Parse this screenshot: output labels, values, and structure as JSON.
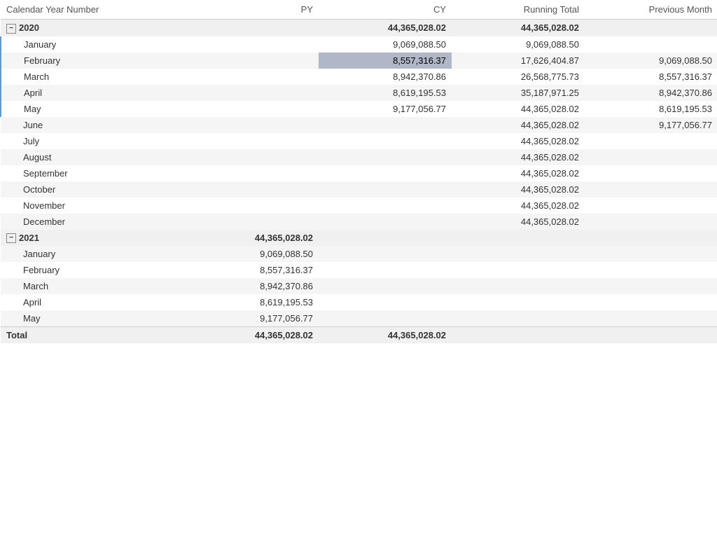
{
  "columns": [
    {
      "key": "name",
      "label": "Calendar Year Number",
      "numeric": false
    },
    {
      "key": "py",
      "label": "PY",
      "numeric": true
    },
    {
      "key": "cy",
      "label": "CY",
      "numeric": true
    },
    {
      "key": "rt",
      "label": "Running Total",
      "numeric": true
    },
    {
      "key": "pm",
      "label": "Previous Month",
      "numeric": true
    }
  ],
  "rows": [
    {
      "type": "year",
      "label": "2020",
      "py": "",
      "cy": "44,365,028.02",
      "rt": "44,365,028.02",
      "pm": ""
    },
    {
      "type": "month",
      "label": "January",
      "py": "",
      "cy": "9,069,088.50",
      "rt": "9,069,088.50",
      "pm": "",
      "selected_cy": false
    },
    {
      "type": "month",
      "label": "February",
      "py": "",
      "cy": "8,557,316.37",
      "rt": "17,626,404.87",
      "pm": "9,069,088.50",
      "selected_cy": true
    },
    {
      "type": "month",
      "label": "March",
      "py": "",
      "cy": "8,942,370.86",
      "rt": "26,568,775.73",
      "pm": "8,557,316.37",
      "selected_cy": false
    },
    {
      "type": "month",
      "label": "April",
      "py": "",
      "cy": "8,619,195.53",
      "rt": "35,187,971.25",
      "pm": "8,942,370.86",
      "selected_cy": false
    },
    {
      "type": "month",
      "label": "May",
      "py": "",
      "cy": "9,177,056.77",
      "rt": "44,365,028.02",
      "pm": "8,619,195.53",
      "selected_cy": false
    },
    {
      "type": "month",
      "label": "June",
      "py": "",
      "cy": "",
      "rt": "44,365,028.02",
      "pm": "9,177,056.77",
      "selected_cy": false
    },
    {
      "type": "month",
      "label": "July",
      "py": "",
      "cy": "",
      "rt": "44,365,028.02",
      "pm": "",
      "selected_cy": false
    },
    {
      "type": "month",
      "label": "August",
      "py": "",
      "cy": "",
      "rt": "44,365,028.02",
      "pm": "",
      "selected_cy": false
    },
    {
      "type": "month",
      "label": "September",
      "py": "",
      "cy": "",
      "rt": "44,365,028.02",
      "pm": "",
      "selected_cy": false
    },
    {
      "type": "month",
      "label": "October",
      "py": "",
      "cy": "",
      "rt": "44,365,028.02",
      "pm": "",
      "selected_cy": false
    },
    {
      "type": "month",
      "label": "November",
      "py": "",
      "cy": "",
      "rt": "44,365,028.02",
      "pm": "",
      "selected_cy": false
    },
    {
      "type": "month",
      "label": "December",
      "py": "",
      "cy": "",
      "rt": "44,365,028.02",
      "pm": "",
      "selected_cy": false
    },
    {
      "type": "year",
      "label": "2021",
      "py": "44,365,028.02",
      "cy": "",
      "rt": "",
      "pm": ""
    },
    {
      "type": "month",
      "label": "January",
      "py": "9,069,088.50",
      "cy": "",
      "rt": "",
      "pm": "",
      "selected_cy": false
    },
    {
      "type": "month",
      "label": "February",
      "py": "8,557,316.37",
      "cy": "",
      "rt": "",
      "pm": "",
      "selected_cy": false
    },
    {
      "type": "month",
      "label": "March",
      "py": "8,942,370.86",
      "cy": "",
      "rt": "",
      "pm": "",
      "selected_cy": false
    },
    {
      "type": "month",
      "label": "April",
      "py": "8,619,195.53",
      "cy": "",
      "rt": "",
      "pm": "",
      "selected_cy": false
    },
    {
      "type": "month",
      "label": "May",
      "py": "9,177,056.77",
      "cy": "",
      "rt": "",
      "pm": "",
      "selected_cy": false
    },
    {
      "type": "total",
      "label": "Total",
      "py": "44,365,028.02",
      "cy": "44,365,028.02",
      "rt": "",
      "pm": ""
    }
  ],
  "ui": {
    "collapse_icon": "−"
  }
}
